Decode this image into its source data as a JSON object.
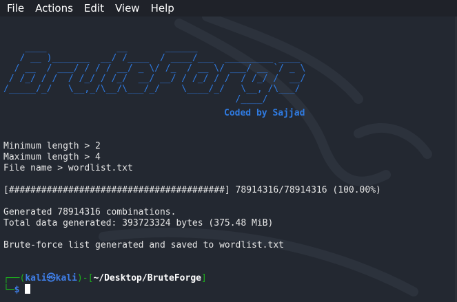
{
  "menu": {
    "items": [
      "File",
      "Actions",
      "Edit",
      "View",
      "Help"
    ]
  },
  "banner": {
    "ascii_art": "    ____             __       ______                    \n   / __ )_______  __/ /____  / ____/___  _________ ____ \n  / __  / ___/ / / / __/ _ \\/ /_  / __ \\/ ___/ __ `/ _ \\\n / /_/ / /  / /_/ / /_/  __/ __/ / /_/ / /  / /_/ /  __/\n/_____/_/   \\__,_/\\__/\\___/_/    \\____/_/   \\__, /\\___/ \n                                           /____/       ",
    "credit": "Coded by Sajjad"
  },
  "output": {
    "min_length": "Minimum length > 2",
    "max_length": "Maximum length > 4",
    "file_name": "File name > wordlist.txt",
    "progress": "[########################################] 78914316/78914316 (100.00%)",
    "generated": "Generated 78914316 combinations.",
    "total_data": "Total data generated: 393723324 bytes (375.48 MiB)",
    "saved": "Brute-force list generated and saved to wordlist.txt"
  },
  "prompt": {
    "corner_top": "┌──(",
    "user": "kali",
    "at": "㉿",
    "host": "kali",
    "sep": ")-[",
    "path": "~/Desktop/BruteForge",
    "close": "]",
    "corner_bottom": "└─",
    "symbol": "$"
  },
  "colors": {
    "background": "#232831",
    "menubar": "#1f2229",
    "banner_blue": "#2f7be2",
    "prompt_green": "#1db31d",
    "prompt_blue": "#3f7ee6"
  }
}
